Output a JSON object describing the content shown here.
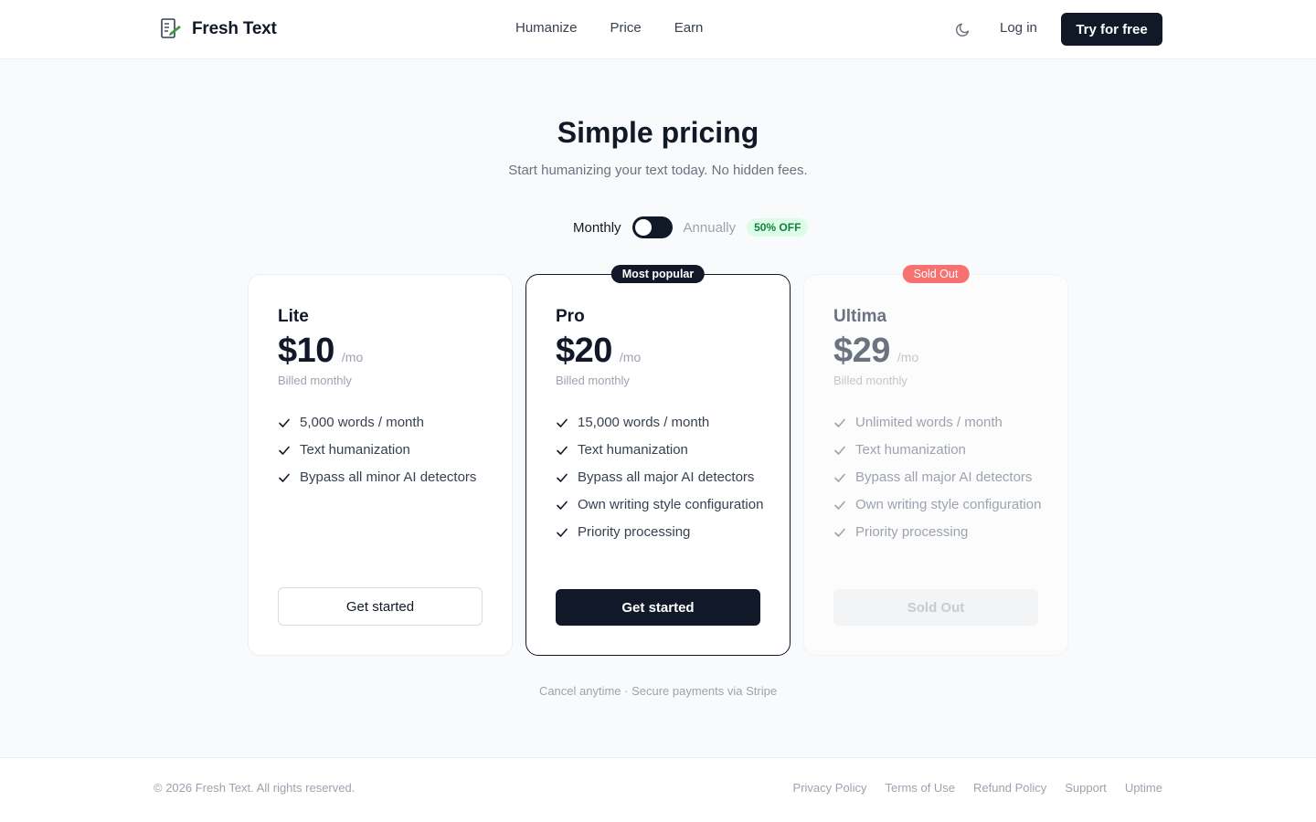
{
  "header": {
    "brand": "Fresh Text",
    "nav": [
      "Humanize",
      "Price",
      "Earn"
    ],
    "login": "Log in",
    "cta": "Try for free",
    "theme_icon": "moon-icon"
  },
  "hero": {
    "title": "Simple pricing",
    "subtitle": "Start humanizing your text today. No hidden fees."
  },
  "billing": {
    "monthly": "Monthly",
    "annually": "Annually",
    "discount": "50% OFF",
    "selected": "Monthly"
  },
  "plans": [
    {
      "name": "Lite",
      "price": "$10",
      "per": "/mo",
      "billed": "Billed monthly",
      "features": [
        "5,000 words / month",
        "Text humanization",
        "Bypass all minor AI detectors"
      ],
      "button": "Get started"
    },
    {
      "name": "Pro",
      "badge": "Most popular",
      "price": "$20",
      "per": "/mo",
      "billed": "Billed monthly",
      "features": [
        "15,000 words / month",
        "Text humanization",
        "Bypass all major AI detectors",
        "Own writing style configuration",
        "Priority processing"
      ],
      "button": "Get started"
    },
    {
      "name": "Ultima",
      "badge": "Sold Out",
      "price": "$29",
      "per": "/mo",
      "billed": "Billed monthly",
      "features": [
        "Unlimited words / month",
        "Text humanization",
        "Bypass all major AI detectors",
        "Own writing style configuration",
        "Priority processing"
      ],
      "button": "Sold Out"
    }
  ],
  "footnote": "Cancel anytime · Secure payments via Stripe",
  "footer": {
    "copyright": "© 2026 Fresh Text. All rights reserved.",
    "links": [
      "Privacy Policy",
      "Terms of Use",
      "Refund Policy",
      "Support",
      "Uptime"
    ]
  },
  "colors": {
    "primary": "#111827",
    "background": "#f9fafb",
    "discount_bg": "#dcfce7",
    "discount_text": "#15803d",
    "sold_out_badge": "#f87171",
    "brand_accent": "#3f9b3f"
  }
}
